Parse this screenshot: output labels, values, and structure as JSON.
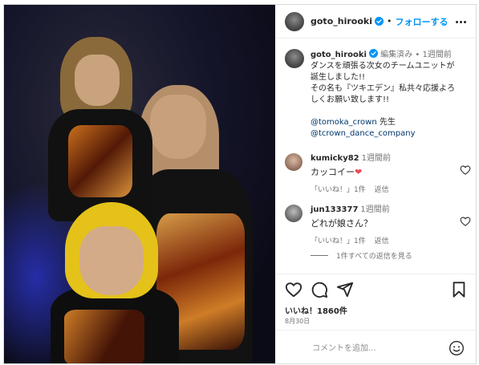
{
  "post_header": {
    "username": "goto_hirooki",
    "separator": "•",
    "follow_label": "フォローする"
  },
  "caption": {
    "username": "goto_hirooki",
    "edited": "編集済み",
    "separator": "•",
    "time": "1週間前",
    "text": "ダンスを頑張る次女のチームユニットが\n誕生しました!!\nその名も『ツキエデン』私共々応援よろ\nしくお願い致します!!",
    "mention1": "@tomoka_crown",
    "mention1_suffix": " 先生",
    "mention2": "@tcrown_dance_company"
  },
  "comments": [
    {
      "username": "kumicky82",
      "time": "1週間前",
      "text": "カッコイー",
      "emoji": "❤",
      "likes_label": "「いいね！」1件",
      "reply_label": "返信"
    },
    {
      "username": "jun133377",
      "time": "1週間前",
      "text": "どれが娘さん？",
      "emoji": "",
      "likes_label": "「いいね！」1件",
      "reply_label": "返信"
    }
  ],
  "view_replies_label": "1件すべての返信を見る",
  "likes_text": "いいね！1860件",
  "date_text": "8月30日",
  "add_comment": {
    "placeholder": "コメントを追加..."
  },
  "colors": {
    "follow_blue": "#0095f6",
    "verified_blue": "#0095f6",
    "mention_blue": "#00376b",
    "heart_red": "#ed4956"
  },
  "icons": {
    "like": "heart-outline-icon",
    "comment": "comment-icon",
    "share": "paper-plane-icon",
    "save": "bookmark-icon",
    "more": "more-dots-icon",
    "emoji": "smiley-icon"
  }
}
